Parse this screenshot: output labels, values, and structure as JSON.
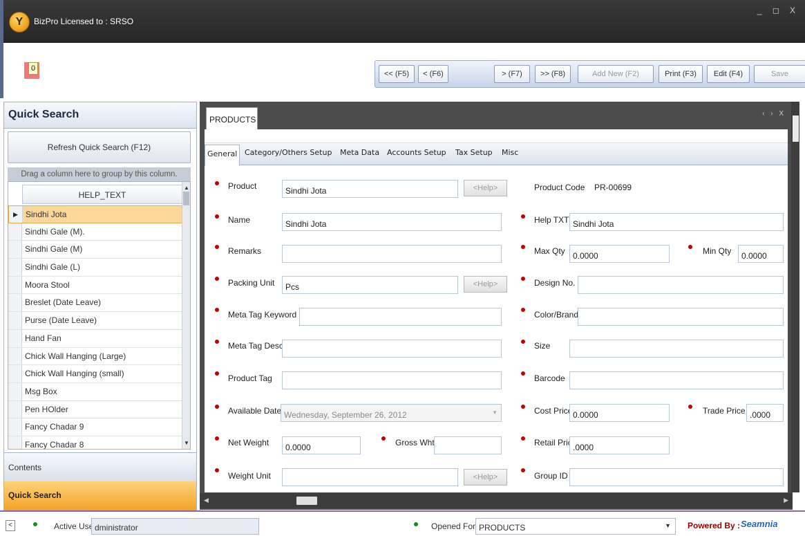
{
  "window": {
    "title": "BizPro Licensed to : SRSO",
    "controls": "_ ◻ X"
  },
  "counter": {
    "value": "0"
  },
  "toolbar": {
    "first": "<< (F5)",
    "prev": "< (F6)",
    "next": "> (F7)",
    "last": ">> (F8)",
    "add_new": "Add New (F2)",
    "print": "Print (F3)",
    "edit": "Edit (F4)",
    "save": "Save"
  },
  "quick_search": {
    "title": "Quick Search",
    "refresh": "Refresh Quick Search (F12)",
    "group_hint": "Drag a column here to group by this column.",
    "column": "HELP_TEXT",
    "rows": [
      "Sindhi Jota",
      "Sindhi Gale (M).",
      "Sindhi Gale (M)",
      "Sindhi Gale (L)",
      "Moora Stool",
      "Breslet (Date Leave)",
      "Purse (Date Leave)",
      "Hand Fan",
      "Chick Wall Hanging (Large)",
      "Chick Wall Hanging (small)",
      "Msg Box",
      "Pen HOlder",
      "Fancy Chadar 9",
      "Fancy Chadar 8"
    ],
    "contents_label": "Contents",
    "bottom_label": "Quick Search"
  },
  "document": {
    "tab": "PRODUCTS",
    "tab_controls": "‹ › X"
  },
  "form_tabs": [
    "General",
    "Category/Others Setup",
    "Meta Data",
    "Accounts Setup",
    "Tax Setup",
    "Misc"
  ],
  "form": {
    "help_label": "<Help>",
    "product_label": "Product",
    "product_value": "Sindhi Jota",
    "product_code_label": "Product Code",
    "product_code_value": "PR-00699",
    "name_label": "Name",
    "name_value": "Sindhi Jota",
    "help_txt_label": "Help TXT",
    "help_txt_value": "Sindhi Jota",
    "remarks_label": "Remarks",
    "remarks_value": "",
    "max_qty_label": "Max Qty",
    "max_qty_value": "0.0000",
    "min_qty_label": "Min Qty",
    "min_qty_value": "0.0000",
    "packing_unit_label": "Packing Unit",
    "packing_unit_value": "Pcs",
    "design_no_label": "Design No.",
    "design_no_value": "",
    "meta_keyword_label": "Meta Tag Keyword",
    "meta_keyword_value": "",
    "color_brand_label": "Color/Brand",
    "color_brand_value": "",
    "meta_desc_label": "Meta Tag Desc.",
    "meta_desc_value": "",
    "size_label": "Size",
    "size_value": "",
    "product_tag_label": "Product Tag",
    "product_tag_value": "",
    "barcode_label": "Barcode",
    "barcode_value": "",
    "available_date_label": "Available Date",
    "available_date_value": "Wednesday, September 26, 2012",
    "cost_price_label": "Cost Price",
    "cost_price_value": "0.0000",
    "trade_price_label": "Trade Price",
    "trade_price_value": ".0000",
    "net_weight_label": "Net Weight",
    "net_weight_value": "0.0000",
    "gross_wht_label": "Gross Wht",
    "gross_wht_value": "",
    "retail_price_label": "Retail Price",
    "retail_price_value": ".0000",
    "weight_unit_label": "Weight Unit",
    "weight_unit_value": "",
    "group_id_label": "Group ID",
    "group_id_value": ""
  },
  "status": {
    "back": "<",
    "active_user_label": "Active User",
    "active_user_value": "dministrator",
    "opened_form_label": "Opened For",
    "opened_form_value": "PRODUCTS",
    "powered_by": "Powered By :",
    "brand": "Seamnia"
  },
  "colors": {
    "titlebar": "#2c2c2c",
    "required_dot": "#c00000",
    "status_dot": "#1e8a1e",
    "selected_row": "#fbd79b",
    "quick_search_tab": "#f4a32a"
  }
}
